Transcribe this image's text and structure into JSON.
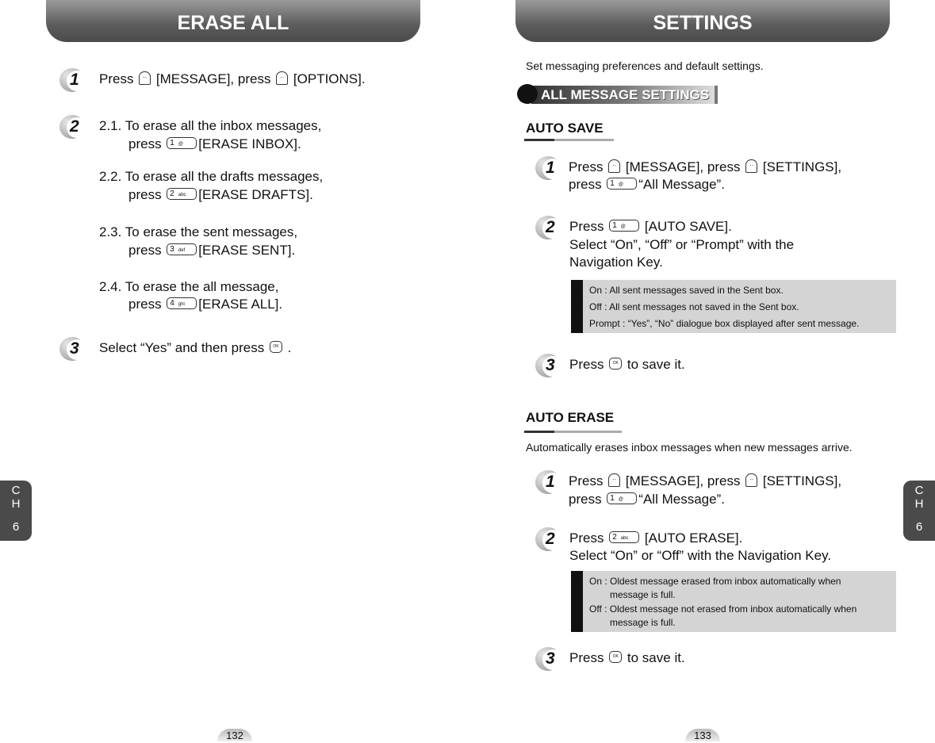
{
  "left": {
    "title": "ERASE ALL",
    "steps": [
      "1",
      "2",
      "3"
    ],
    "lines": [
      [
        {
          "t": "Press "
        },
        {
          "k": "soft"
        },
        {
          "t": " [MESSAGE], press "
        },
        {
          "k": "soft"
        },
        {
          "t": " [OPTIONS]."
        }
      ],
      [
        {
          "t": "2.1. To erase all the inbox messages,"
        }
      ],
      [
        {
          "t": "press "
        },
        {
          "k": "num",
          "d": "1",
          "s": "@"
        },
        {
          "t": "[ERASE INBOX]."
        }
      ],
      [
        {
          "t": "2.2. To erase all the drafts messages,"
        }
      ],
      [
        {
          "t": "press "
        },
        {
          "k": "num",
          "d": "2",
          "s": "abc"
        },
        {
          "t": "[ERASE DRAFTS]."
        }
      ],
      [
        {
          "t": "2.3. To erase the sent messages,"
        }
      ],
      [
        {
          "t": "press "
        },
        {
          "k": "num",
          "d": "3",
          "s": "def"
        },
        {
          "t": "[ERASE SENT]."
        }
      ],
      [
        {
          "t": "2.4. To erase the all message,"
        }
      ],
      [
        {
          "t": "press "
        },
        {
          "k": "num",
          "d": "4",
          "s": "ghi"
        },
        {
          "t": "[ERASE ALL]."
        }
      ],
      [
        {
          "t": "Select “Yes” and then press "
        },
        {
          "k": "ok"
        },
        {
          "t": " ."
        }
      ]
    ],
    "page": "132",
    "chapter": {
      "c": "C",
      "h": "H",
      "n": "6"
    }
  },
  "right": {
    "title": "SETTINGS",
    "intro": "Set messaging preferences and default settings.",
    "banner": "ALL MESSAGE SETTINGS",
    "auto_save": {
      "heading": "AUTO SAVE",
      "steps": [
        "1",
        "2",
        "3"
      ],
      "lines": [
        [
          {
            "t": "Press "
          },
          {
            "k": "soft"
          },
          {
            "t": " [MESSAGE], press "
          },
          {
            "k": "soft"
          },
          {
            "t": " [SETTINGS],"
          }
        ],
        [
          {
            "t": "press "
          },
          {
            "k": "num",
            "d": "1",
            "s": "@"
          },
          {
            "t": "“All Message”."
          }
        ],
        [
          {
            "t": "Press "
          },
          {
            "k": "num",
            "d": "1",
            "s": "@"
          },
          {
            "t": " [AUTO SAVE]."
          }
        ],
        [
          {
            "t": "Select “On”, “Off” or “Prompt” with the"
          }
        ],
        [
          {
            "t": "Navigation Key."
          }
        ],
        [
          {
            "t": "Press "
          },
          {
            "k": "ok"
          },
          {
            "t": " to save it."
          }
        ]
      ],
      "notes": [
        "On : All sent messages saved in the Sent box.",
        "Off : All sent messages not saved in the Sent box.",
        "Prompt : “Yes”, “No” dialogue box displayed after sent message."
      ]
    },
    "auto_erase": {
      "heading": "AUTO ERASE",
      "desc": "Automatically erases inbox messages when new messages arrive.",
      "steps": [
        "1",
        "2",
        "3"
      ],
      "lines": [
        [
          {
            "t": "Press "
          },
          {
            "k": "soft"
          },
          {
            "t": " [MESSAGE], press "
          },
          {
            "k": "soft"
          },
          {
            "t": " [SETTINGS],"
          }
        ],
        [
          {
            "t": "press "
          },
          {
            "k": "num",
            "d": "1",
            "s": "@"
          },
          {
            "t": "“All Message”."
          }
        ],
        [
          {
            "t": "Press "
          },
          {
            "k": "num",
            "d": "2",
            "s": "abc"
          },
          {
            "t": " [AUTO ERASE]."
          }
        ],
        [
          {
            "t": "Select “On” or “Off” with the Navigation Key."
          }
        ],
        [
          {
            "t": "Press "
          },
          {
            "k": "ok"
          },
          {
            "t": " to save it."
          }
        ]
      ],
      "notes": [
        "On : Oldest message erased from inbox automatically when",
        "message is full.",
        "Off : Oldest message not erased from inbox automatically when",
        "message is full."
      ]
    },
    "page": "133",
    "chapter": {
      "c": "C",
      "h": "H",
      "n": "6"
    }
  },
  "key_icons": {
    "soft": "soft-key-icon",
    "num": "number-key-icon",
    "ok": "ok-key-icon",
    "soft_glyph": "··",
    "ok_glyph": "OK"
  }
}
